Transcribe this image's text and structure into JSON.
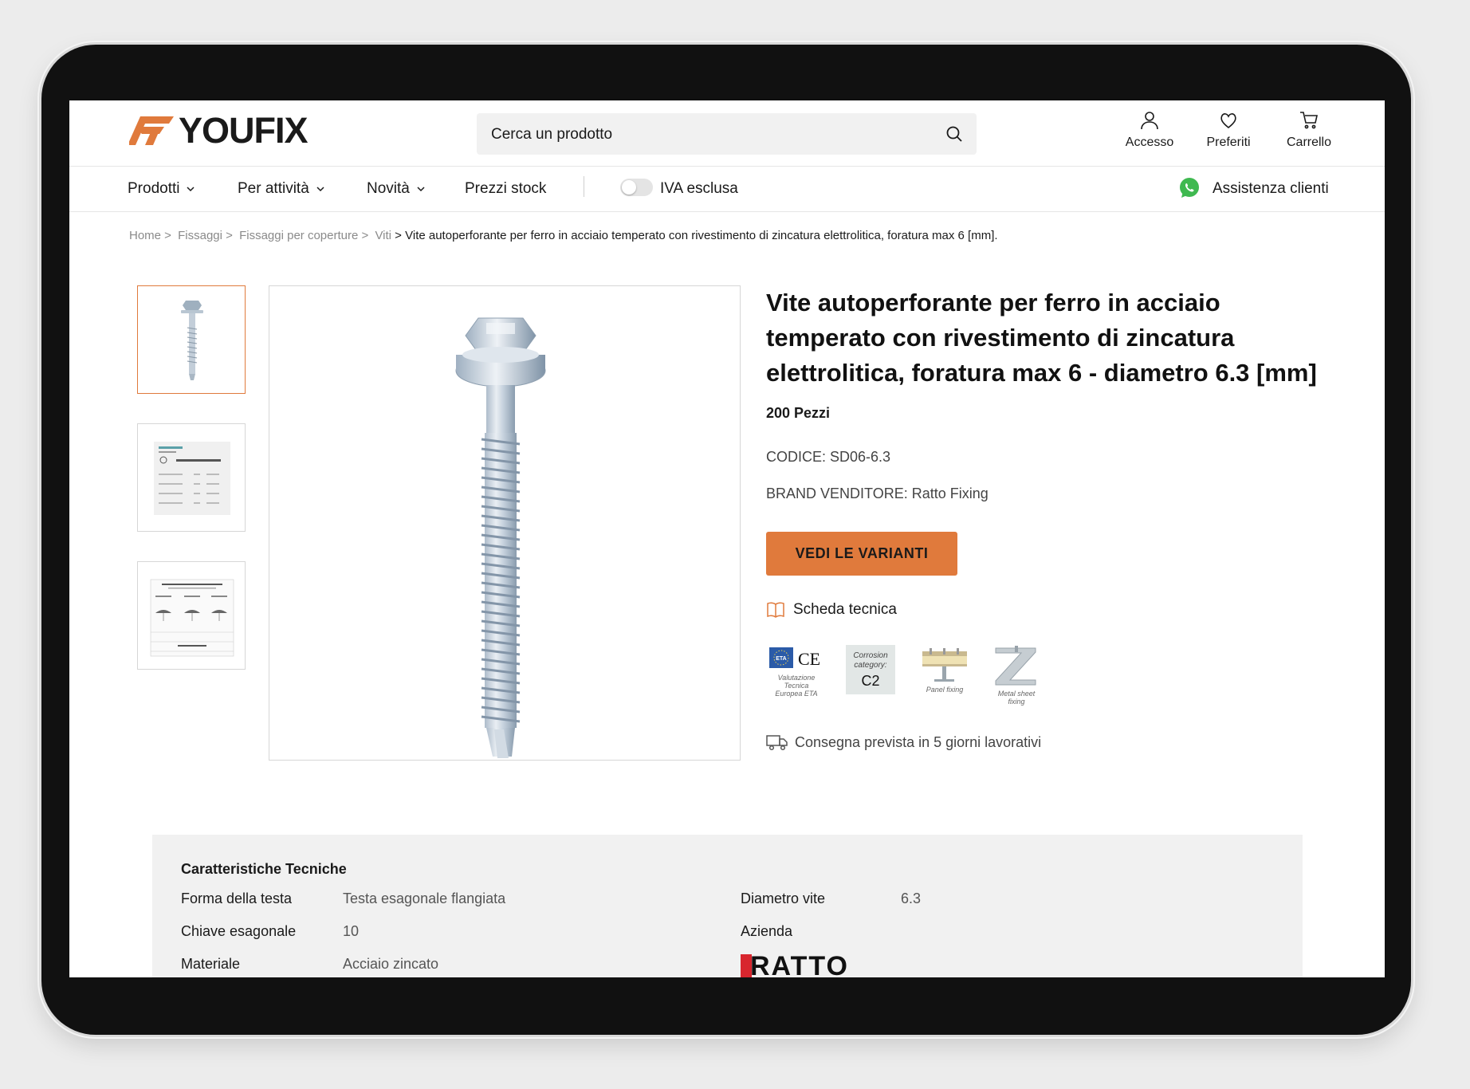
{
  "brand": {
    "name": "YOUFIX",
    "accent_color": "#e07a3c"
  },
  "search": {
    "placeholder": "Cerca un prodotto"
  },
  "header_actions": {
    "login": "Accesso",
    "favorites": "Preferiti",
    "cart": "Carrello"
  },
  "nav": {
    "products": "Prodotti",
    "by_activity": "Per attività",
    "news": "Novità",
    "stock_prices": "Prezzi stock",
    "vat_toggle": "IVA esclusa",
    "support": "Assistenza clienti"
  },
  "breadcrumb": {
    "home": "Home >",
    "l1": "Fissaggi >",
    "l2": "Fissaggi per coperture >",
    "l3": "Viti",
    "sep": " > ",
    "current": "Vite autoperforante per ferro in acciaio temperato con rivestimento di zincatura elettrolitica, foratura max 6 [mm]."
  },
  "product": {
    "title": "Vite autoperforante per ferro in  acciaio temperato con rivestimento di  zincatura elettrolitica, foratura max 6 - diametro 6.3 [mm]",
    "quantity": "200 Pezzi",
    "code": "CODICE: SD06-6.3",
    "seller_brand": "BRAND VENDITORE: Ratto Fixing",
    "cta": "VEDI LE VARIANTI",
    "datasheet": "Scheda tecnica",
    "delivery": "Consegna prevista in 5 giorni lavorativi"
  },
  "badges": {
    "eta_caption": "Valutazione Tecnica Europea ETA",
    "eta_text": "ETA",
    "ce_text": "CE",
    "corrosion_label": "Corrosion category:",
    "corrosion_value": "C2",
    "panel_caption": "Panel fixing",
    "metal_caption": "Metal sheet fixing"
  },
  "specs": {
    "title": "Caratteristiche Tecniche",
    "rows": [
      {
        "key": "Forma della testa",
        "value": "Testa esagonale flangiata"
      },
      {
        "key": "Chiave esagonale",
        "value": "10"
      },
      {
        "key": "Materiale",
        "value": "Acciaio zincato"
      }
    ],
    "right_rows": [
      {
        "key": "Diametro vite",
        "value": "6.3"
      },
      {
        "key": "Azienda",
        "value": ""
      }
    ],
    "company_logo_text": "RATTO"
  }
}
